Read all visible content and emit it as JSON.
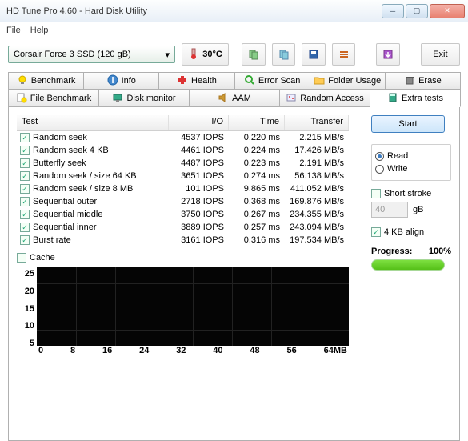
{
  "window": {
    "title": "HD Tune Pro 4.60 - Hard Disk Utility"
  },
  "menu": {
    "file": "File",
    "help": "Help"
  },
  "drive": {
    "selected": "Corsair Force 3 SSD (120 gB)"
  },
  "temp": {
    "value": "30°C"
  },
  "toolbar": {
    "exit": "Exit"
  },
  "tabs": {
    "row1": [
      {
        "label": "Benchmark",
        "icon": "lightbulb"
      },
      {
        "label": "Info",
        "icon": "info"
      },
      {
        "label": "Health",
        "icon": "health"
      },
      {
        "label": "Error Scan",
        "icon": "search"
      },
      {
        "label": "Folder Usage",
        "icon": "folder"
      },
      {
        "label": "Erase",
        "icon": "trash"
      }
    ],
    "row2": [
      {
        "label": "File Benchmark",
        "icon": "file-bulb"
      },
      {
        "label": "Disk monitor",
        "icon": "monitor"
      },
      {
        "label": "AAM",
        "icon": "speaker"
      },
      {
        "label": "Random Access",
        "icon": "random"
      },
      {
        "label": "Extra tests",
        "icon": "calc",
        "active": true
      }
    ]
  },
  "table": {
    "headers": {
      "test": "Test",
      "io": "I/O",
      "time": "Time",
      "transfer": "Transfer"
    },
    "rows": [
      {
        "name": "Random seek",
        "io": "4537 IOPS",
        "time": "0.220 ms",
        "tx": "2.215 MB/s"
      },
      {
        "name": "Random seek 4 KB",
        "io": "4461 IOPS",
        "time": "0.224 ms",
        "tx": "17.426 MB/s"
      },
      {
        "name": "Butterfly seek",
        "io": "4487 IOPS",
        "time": "0.223 ms",
        "tx": "2.191 MB/s"
      },
      {
        "name": "Random seek / size 64 KB",
        "io": "3651 IOPS",
        "time": "0.274 ms",
        "tx": "56.138 MB/s"
      },
      {
        "name": "Random seek / size 8 MB",
        "io": "101 IOPS",
        "time": "9.865 ms",
        "tx": "411.052 MB/s"
      },
      {
        "name": "Sequential outer",
        "io": "2718 IOPS",
        "time": "0.368 ms",
        "tx": "169.876 MB/s"
      },
      {
        "name": "Sequential middle",
        "io": "3750 IOPS",
        "time": "0.267 ms",
        "tx": "234.355 MB/s"
      },
      {
        "name": "Sequential inner",
        "io": "3889 IOPS",
        "time": "0.257 ms",
        "tx": "243.094 MB/s"
      },
      {
        "name": "Burst rate",
        "io": "3161 IOPS",
        "time": "0.316 ms",
        "tx": "197.534 MB/s"
      }
    ]
  },
  "side": {
    "start": "Start",
    "read": "Read",
    "write": "Write",
    "short_stroke": "Short stroke",
    "stroke_val": "40",
    "stroke_unit": "gB",
    "align": "4 KB align",
    "progress_label": "Progress:",
    "progress_value": "100%"
  },
  "cache": {
    "label": "Cache"
  },
  "chart_data": {
    "type": "line",
    "title": "",
    "ylabel": "MB/s",
    "xlabel": "",
    "y_ticks": [
      "25",
      "20",
      "15",
      "10",
      "5"
    ],
    "x_ticks": [
      "0",
      "8",
      "16",
      "24",
      "32",
      "40",
      "48",
      "56",
      "64MB"
    ],
    "ylim": [
      0,
      25
    ],
    "xlim": [
      0,
      64
    ],
    "series": [
      {
        "name": "cache",
        "values": []
      }
    ]
  }
}
